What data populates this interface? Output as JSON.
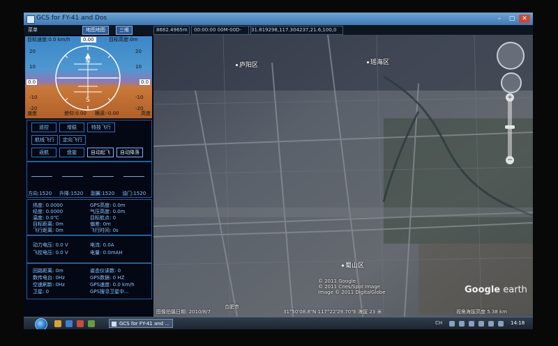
{
  "window": {
    "title": "GCS for FY-41 and Dos",
    "buttons": {
      "minimize": "–",
      "maximize": "▢",
      "close": "✕"
    }
  },
  "toolbar": {
    "menu": "菜单",
    "map_button": "地图地图",
    "view_3d_button": "三维",
    "distance": "8682.4965m",
    "time": "00:00:00 00M-00D-00Y",
    "coordinates": "31.819298,117.304237,21.6,100,0"
  },
  "attitude": {
    "target_speed": "目标速度:0.0 km/h",
    "target_altitude": "目标高度:0m",
    "top_value": "0.00",
    "speed_tape": [
      "20",
      "10",
      "0.0",
      "-10",
      "-20"
    ],
    "altitude_tape": [
      "20",
      "10",
      "0.0",
      "-10",
      "-20"
    ],
    "speed_label": "速度",
    "altitude_label": "高度",
    "pitch_label": "俯仰:0.00",
    "roll_label": "横滚:-0.00",
    "compass": {
      "n": "N",
      "s": "S"
    }
  },
  "controls": [
    {
      "label": "遥控",
      "active": false
    },
    {
      "label": "增稳",
      "active": false
    },
    {
      "label": "特技飞行",
      "active": false
    },
    {
      "label": "航线飞行",
      "active": false
    },
    {
      "label": "定向飞行",
      "active": false
    },
    {
      "label": "返航",
      "active": false
    },
    {
      "label": "盘旋",
      "active": false
    },
    {
      "label": "自动起飞",
      "active": true
    },
    {
      "label": "自动降落",
      "active": true
    }
  ],
  "sticks": [
    "方向:1520",
    "升降:1520",
    "副翼:1520",
    "油门:1520"
  ],
  "status_a": [
    [
      "纬度: 0.0000",
      "GPS高度: 0.0m"
    ],
    [
      "经度: 0.0000",
      "气压高度: 0.0m"
    ],
    [
      "温度: 0.0℃",
      "目标航点: 0"
    ],
    [
      "目标距离: 0m",
      "偏差: 0m"
    ],
    [
      "飞行距离: 0m",
      "飞行时间: 0s"
    ]
  ],
  "status_b": [
    [
      "动力电压: 0.0 V",
      "电流: 0.0A"
    ],
    [
      "飞控电压: 0.0 V",
      "电量: 0.0mAH"
    ]
  ],
  "status_c": [
    [
      "回路距离: 0m",
      "姿态仪读数: 0"
    ],
    [
      "数传电台: 0Hz",
      "GPS数据: 0 HZ"
    ],
    [
      "空速刷新: 0Hz",
      "GPS速度: 0.0 km/h"
    ],
    [
      "卫星: 0",
      "GPS搜寻卫星中..."
    ]
  ],
  "map": {
    "places": [
      {
        "name": "庐阳区"
      },
      {
        "name": "瑶海区"
      },
      {
        "name": "蜀山区"
      }
    ],
    "copyright": "© 2011 Google\n© 2011 Cnes/Spot Image\nImage © 2011 DigitalGlobe",
    "bottom_left": "图像拍摄日期: 2010/8/7",
    "bottom_mid": "31°50'08.8\"N 117°22'29.70\"E 海拔 23 米",
    "bottom_right": "视角海拔高度 5.38 km",
    "brand_google": "Google",
    "brand_earth": "earth",
    "small_label": "合肥市"
  },
  "taskbar": {
    "app_label": "GCS for FY-41 and ...",
    "lang": "CH",
    "time": "14:18"
  }
}
